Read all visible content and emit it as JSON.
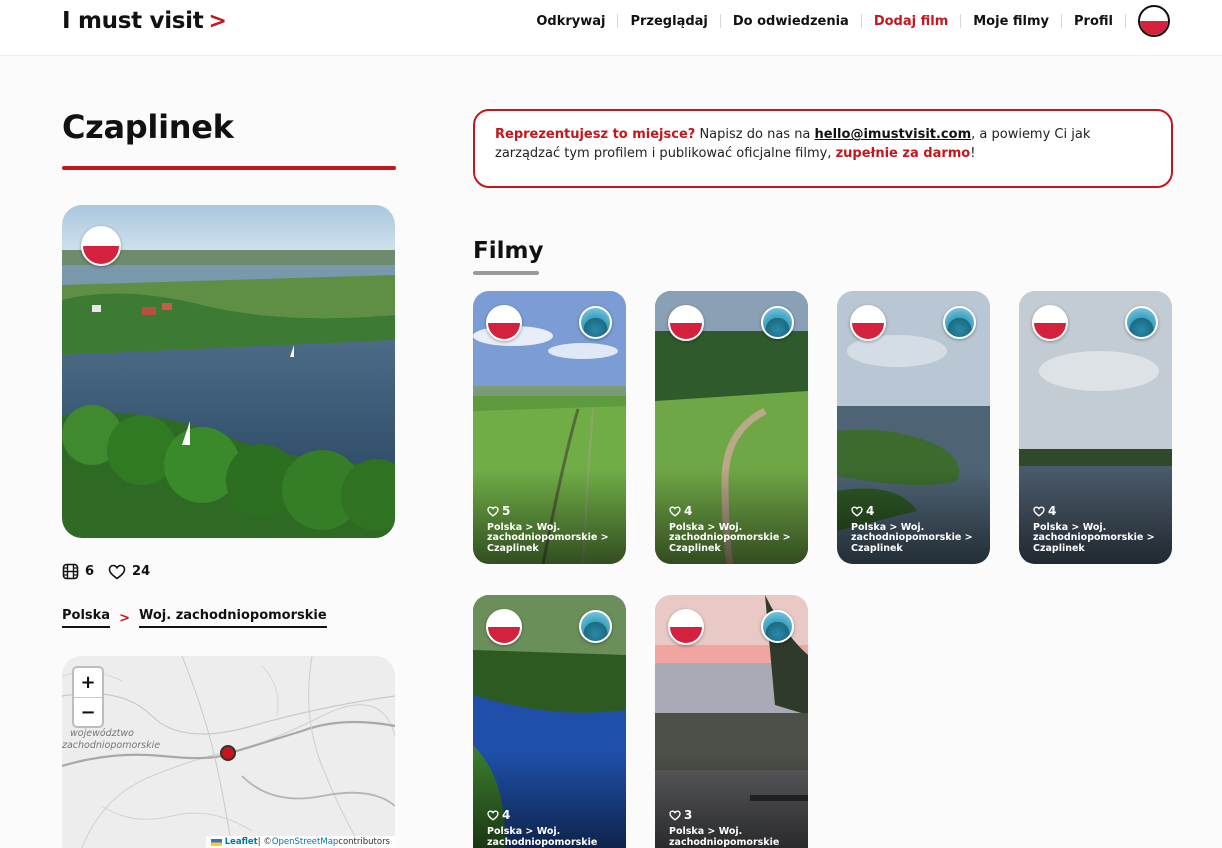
{
  "header": {
    "logo": "I must visit",
    "logo_chevron": ">",
    "nav": [
      {
        "label": "Odkrywaj",
        "active": false
      },
      {
        "label": "Przeglądaj",
        "active": false
      },
      {
        "label": "Do odwiedzenia",
        "active": false
      },
      {
        "label": "Dodaj film",
        "active": true
      },
      {
        "label": "Moje filmy",
        "active": false
      },
      {
        "label": "Profil",
        "active": false
      }
    ],
    "language_icon": "polish-flag-icon"
  },
  "place": {
    "name": "Czaplinek",
    "films_count": "6",
    "likes_count": "24",
    "breadcrumb": [
      "Polska",
      "Woj. zachodniopomorskie"
    ],
    "breadcrumb_separator": ">"
  },
  "map": {
    "zoom_in": "+",
    "zoom_out": "−",
    "label_line1": "województwo",
    "label_line2": "zachodniopomorskie",
    "attribution_leaflet": "Leaflet",
    "attribution_sep": " | © ",
    "attribution_osm": "OpenStreetMap",
    "attribution_tail": " contributors"
  },
  "notice": {
    "lead": "Reprezentujesz to miejsce?",
    "text1": " Napisz do nas na ",
    "email": "hello@imustvisit.com",
    "text2": ", a powiemy Ci jak zarządzać tym profilem i publikować oficjalne filmy, ",
    "emph": "zupełnie za darmo",
    "text3": "!"
  },
  "films": {
    "title": "Filmy",
    "items": [
      {
        "likes": "5",
        "location": "Polska > Woj. zachodniopomorskie > Czaplinek"
      },
      {
        "likes": "4",
        "location": "Polska > Woj. zachodniopomorskie > Czaplinek"
      },
      {
        "likes": "4",
        "location": "Polska > Woj. zachodniopomorskie > Czaplinek"
      },
      {
        "likes": "4",
        "location": "Polska > Woj. zachodniopomorskie > Czaplinek"
      },
      {
        "likes": "4",
        "location": "Polska > Woj. zachodniopomorskie"
      },
      {
        "likes": "3",
        "location": "Polska > Woj. zachodniopomorskie"
      }
    ]
  },
  "colors": {
    "brand": "#c4161c",
    "flag_red": "#d4213d"
  }
}
